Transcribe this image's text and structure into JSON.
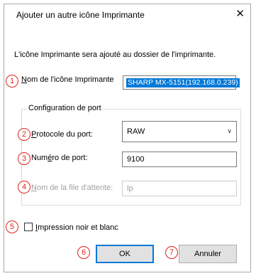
{
  "window": {
    "title": "Ajouter un autre icône Imprimante",
    "close_glyph": "✕",
    "close_icon": "close-icon"
  },
  "description": "L'icône Imprimante sera ajouté au dossier de l'imprimante.",
  "printer_name": {
    "label_u": "N",
    "label_rest": "om de l'icône Imprimante",
    "value": "SHARP MX-5151(192.168.0.239)"
  },
  "port_group": {
    "title": "Configuration de port",
    "protocol": {
      "label_u": "P",
      "label_rest": "rotocole du port:",
      "value": "RAW",
      "chevron_icon": "chevron-down-icon"
    },
    "port_number": {
      "label_pre": "Num",
      "label_u": "é",
      "label_rest": "ro de port:",
      "value": "9100"
    },
    "queue_name": {
      "label_u": "N",
      "label_rest": "om de la file d'attente:",
      "value": "lp",
      "disabled": true
    }
  },
  "black_white": {
    "label_u": "I",
    "label_rest": "mpression noir et blanc",
    "checked": false
  },
  "buttons": {
    "ok": "OK",
    "cancel": "Annuler"
  },
  "markers": [
    "1",
    "2",
    "3",
    "4",
    "5",
    "6",
    "7"
  ],
  "colors": {
    "marker": "#e2231a",
    "selection": "#0078d7",
    "default_button_border": "#0078d7",
    "button_face": "#e1e1e1"
  }
}
